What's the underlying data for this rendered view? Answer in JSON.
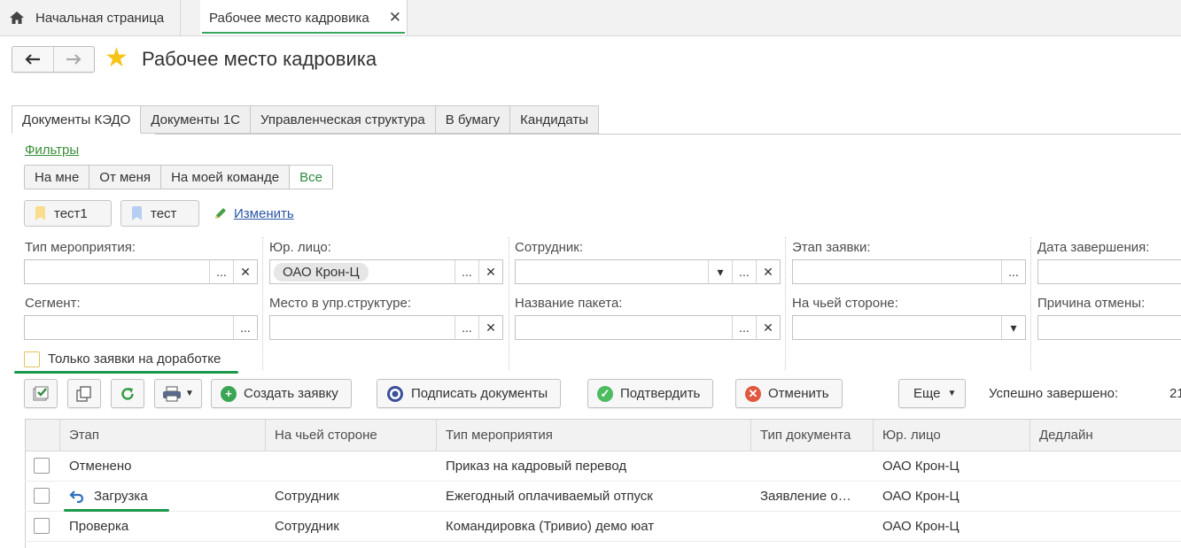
{
  "top_tabs": {
    "home_label": "Начальная страница",
    "active_label": "Рабочее место кадровика",
    "close_glyph": "✕"
  },
  "nav": {
    "back_glyph": "🡐",
    "forward_glyph": "🡒"
  },
  "page_title": "Рабочее место кадровика",
  "form_tabs": [
    "Документы КЭДО",
    "Документы 1С",
    "Управленческая структура",
    "В бумагу",
    "Кандидаты"
  ],
  "filters_link": "Фильтры",
  "segments": [
    "На мне",
    "От меня",
    "На моей команде",
    "Все"
  ],
  "chips": [
    {
      "label": "тест1",
      "color": "#f9dc8c"
    },
    {
      "label": "тест",
      "color": "#b7cdf2"
    }
  ],
  "change_link": "Изменить",
  "fields": {
    "event_type": {
      "label": "Тип мероприятия:",
      "value": ""
    },
    "legal_entity": {
      "label": "Юр. лицо:",
      "value": "ОАО Крон-Ц"
    },
    "employee": {
      "label": "Сотрудник:",
      "value": ""
    },
    "request_stage": {
      "label": "Этап заявки:",
      "value": ""
    },
    "end_date": {
      "label": "Дата завершения:",
      "value": ""
    },
    "segment": {
      "label": "Сегмент:",
      "value": ""
    },
    "org_place": {
      "label": "Место в упр.структуре:",
      "value": ""
    },
    "package_name": {
      "label": "Название пакета:",
      "value": ""
    },
    "whose_side": {
      "label": "На чьей стороне:",
      "value": ""
    },
    "cancel_reason": {
      "label": "Причина отмены:",
      "value": ""
    }
  },
  "only_rework": {
    "label": "Только заявки на доработке",
    "checked": false
  },
  "toolbar": {
    "create": "Создать заявку",
    "sign": "Подписать документы",
    "confirm": "Подтвердить",
    "cancel": "Отменить",
    "more": "Еще",
    "status_label": "Успешно завершено:",
    "status_count": "21"
  },
  "table": {
    "columns": [
      "Этап",
      "На чьей стороне",
      "Тип мероприятия",
      "Тип документа",
      "Юр. лицо",
      "Дедлайн"
    ],
    "rows": [
      {
        "stage": "Отменено",
        "side": "",
        "event": "Приказ на кадровый перевод",
        "doc": "",
        "entity": "ОАО Крон-Ц",
        "deadline": ""
      },
      {
        "stage": "Загрузка",
        "side": "Сотрудник",
        "event": "Ежегодный оплачиваемый отпуск",
        "doc": "Заявление о…",
        "entity": "ОАО Крон-Ц",
        "deadline": ""
      },
      {
        "stage": "Проверка",
        "side": "Сотрудник",
        "event": "Командировка (Тривио) демо юат",
        "doc": "",
        "entity": "ОАО Крон-Ц",
        "deadline": ""
      }
    ]
  },
  "colors": {
    "accent_green": "#3aa55c",
    "link_blue": "#2a55a5",
    "star": "#f6c417"
  }
}
